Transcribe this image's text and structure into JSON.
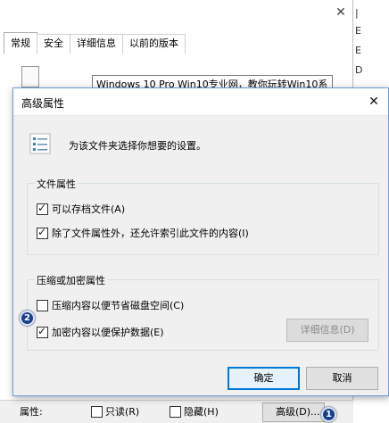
{
  "background_window": {
    "tabs": [
      "常规",
      "安全",
      "详细信息",
      "以前的版本"
    ],
    "active_tab": "常规",
    "file_name": "Windows 10 Pro  Win10专业网，教你玩转Win10系",
    "attributes_label": "属性:",
    "readonly_label": "只读(R)",
    "hidden_label": "隐藏(H)",
    "advanced_button": "高级(D)..."
  },
  "right_strip": {
    "chars": [
      "|",
      "E",
      "E",
      "D"
    ]
  },
  "dialog": {
    "title": "高级属性",
    "header_text": "为该文件夹选择你想要的设置。",
    "file_attributes": {
      "legend": "文件属性",
      "archive_label": "可以存档文件(A)",
      "index_label": "除了文件属性外，还允许索引此文件的内容(I)"
    },
    "compress_encrypt": {
      "legend": "压缩或加密属性",
      "compress_label": "压缩内容以便节省磁盘空间(C)",
      "encrypt_label": "加密内容以便保护数据(E)",
      "details_button": "详细信息(D)"
    },
    "ok_button": "确定",
    "cancel_button": "取消"
  },
  "annotations": {
    "badge_1": "1",
    "badge_2": "2"
  },
  "icons": [
    "close-icon",
    "settings-list-icon",
    "file-icon",
    "checkbox-icon"
  ],
  "colors": {
    "accent": "#0078d7",
    "dialog_border": "#6e9fd6",
    "badge": "#1a3f8c"
  }
}
